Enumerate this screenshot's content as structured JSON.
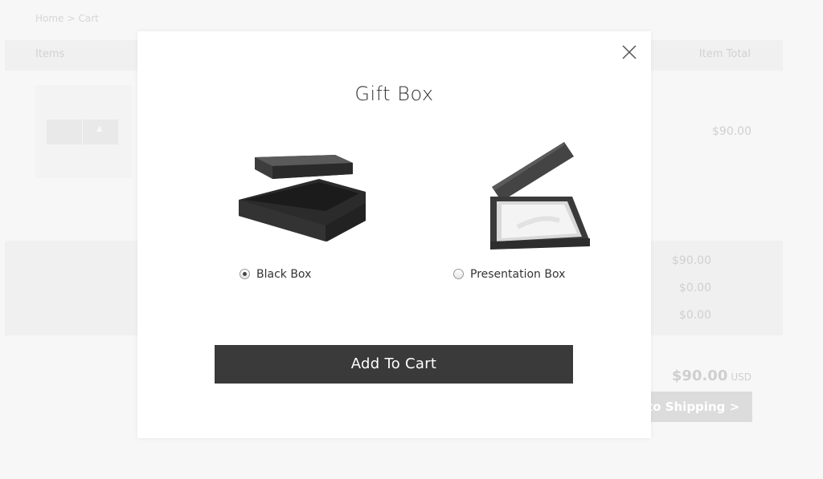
{
  "background": {
    "breadcrumb": [
      "Home",
      ">",
      "Cart"
    ],
    "cart_header": {
      "items_label": "Items",
      "total_label": "Item Total"
    },
    "row_price": "$90.00",
    "summary_lines": [
      "$90.00",
      "$0.00",
      "$0.00"
    ],
    "grand_total": {
      "amount": "$90.00",
      "currency": "USD"
    },
    "shipping_button": "to Shipping >"
  },
  "modal": {
    "title": "Gift Box",
    "options": [
      {
        "label": "Black Box",
        "selected": true
      },
      {
        "label": "Presentation Box",
        "selected": false
      }
    ],
    "add_button": "Add To Cart",
    "close_icon": "close-icon"
  },
  "colors": {
    "button_bg": "#3a3a3a",
    "page_bg": "#f7f7f7"
  }
}
